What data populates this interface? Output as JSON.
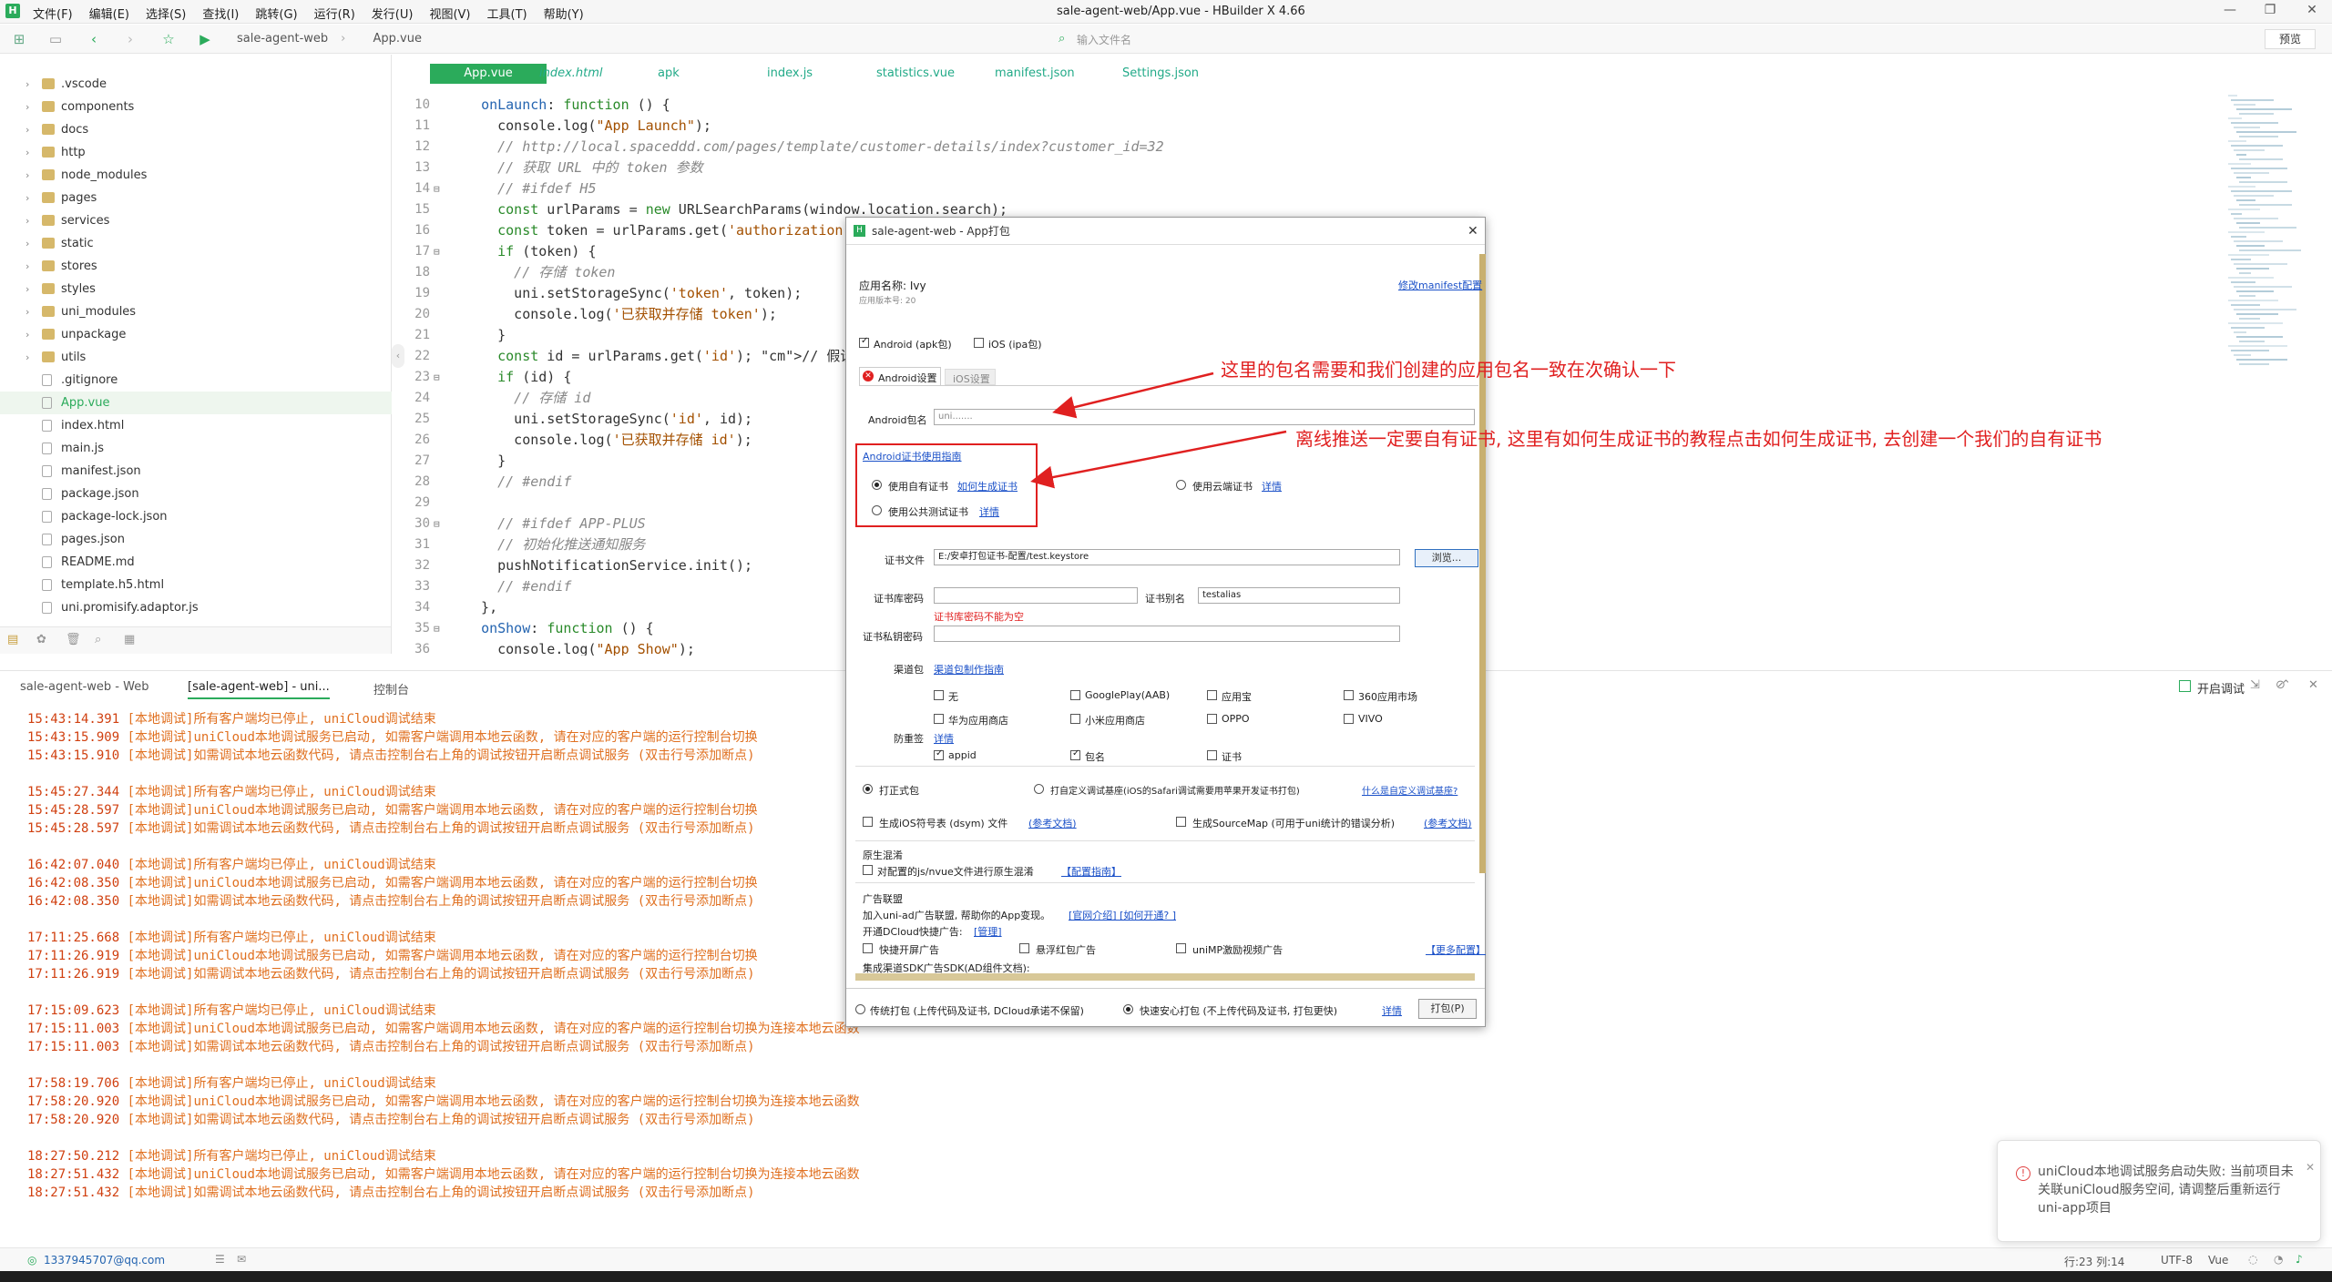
{
  "titlebar": {
    "logo": "H",
    "menus": [
      "文件(F)",
      "编辑(E)",
      "选择(S)",
      "查找(I)",
      "跳转(G)",
      "运行(R)",
      "发行(U)",
      "视图(V)",
      "工具(T)",
      "帮助(Y)"
    ],
    "title": "sale-agent-web/App.vue - HBuilder X 4.66"
  },
  "toolbar": {
    "crumb": [
      "sale-agent-web",
      "App.vue"
    ],
    "file_input_placeholder": "输入文件名",
    "preview": "预览"
  },
  "sidebar": {
    "items": [
      {
        "label": ".vscode",
        "type": "folder"
      },
      {
        "label": "components",
        "type": "folder"
      },
      {
        "label": "docs",
        "type": "folder"
      },
      {
        "label": "http",
        "type": "folder"
      },
      {
        "label": "node_modules",
        "type": "folder"
      },
      {
        "label": "pages",
        "type": "folder"
      },
      {
        "label": "services",
        "type": "folder"
      },
      {
        "label": "static",
        "type": "folder"
      },
      {
        "label": "stores",
        "type": "folder"
      },
      {
        "label": "styles",
        "type": "folder"
      },
      {
        "label": "uni_modules",
        "type": "folder"
      },
      {
        "label": "unpackage",
        "type": "folder"
      },
      {
        "label": "utils",
        "type": "folder"
      },
      {
        "label": ".gitignore",
        "type": "file"
      },
      {
        "label": "App.vue",
        "type": "file",
        "selected": true
      },
      {
        "label": "index.html",
        "type": "file"
      },
      {
        "label": "main.js",
        "type": "file"
      },
      {
        "label": "manifest.json",
        "type": "file"
      },
      {
        "label": "package.json",
        "type": "file"
      },
      {
        "label": "package-lock.json",
        "type": "file"
      },
      {
        "label": "pages.json",
        "type": "file"
      },
      {
        "label": "README.md",
        "type": "file"
      },
      {
        "label": "template.h5.html",
        "type": "file"
      },
      {
        "label": "uni.promisify.adaptor.js",
        "type": "file"
      }
    ]
  },
  "tabs": [
    {
      "label": "App.vue",
      "active": true
    },
    {
      "label": "index.html"
    },
    {
      "label": "apk"
    },
    {
      "label": "index.js"
    },
    {
      "label": "statistics.vue"
    },
    {
      "label": "manifest.json"
    },
    {
      "label": "Settings.json"
    }
  ],
  "code": [
    {
      "n": "10",
      "f": "",
      "t": "  onLaunch: function () {"
    },
    {
      "n": "11",
      "f": "",
      "t": "    console.log(\"App Launch\");"
    },
    {
      "n": "12",
      "f": "",
      "t": "    // http://local.spaceddd.com/pages/template/customer-details/index?customer_id=32"
    },
    {
      "n": "13",
      "f": "",
      "t": "    // 获取 URL 中的 token 参数"
    },
    {
      "n": "14",
      "f": "⊟",
      "t": "    // #ifdef H5"
    },
    {
      "n": "15",
      "f": "",
      "t": "    const urlParams = new URLSearchParams(window.location.search);"
    },
    {
      "n": "16",
      "f": "",
      "t": "    const token = urlParams.get('authorization');"
    },
    {
      "n": "17",
      "f": "⊟",
      "t": "    if (token) {"
    },
    {
      "n": "18",
      "f": "",
      "t": "      // 存储 token"
    },
    {
      "n": "19",
      "f": "",
      "t": "      uni.setStorageSync('token', token);"
    },
    {
      "n": "20",
      "f": "",
      "t": "      console.log('已获取并存储 token');"
    },
    {
      "n": "21",
      "f": "",
      "t": "    }"
    },
    {
      "n": "22",
      "f": "",
      "t": "    const id = urlParams.get('id'); // 假设参数名"
    },
    {
      "n": "23",
      "f": "⊟",
      "t": "    if (id) {"
    },
    {
      "n": "24",
      "f": "",
      "t": "      // 存储 id"
    },
    {
      "n": "25",
      "f": "",
      "t": "      uni.setStorageSync('id', id);"
    },
    {
      "n": "26",
      "f": "",
      "t": "      console.log('已获取并存储 id');"
    },
    {
      "n": "27",
      "f": "",
      "t": "    }"
    },
    {
      "n": "28",
      "f": "",
      "t": "    // #endif"
    },
    {
      "n": "29",
      "f": "",
      "t": ""
    },
    {
      "n": "30",
      "f": "⊟",
      "t": "    // #ifdef APP-PLUS"
    },
    {
      "n": "31",
      "f": "",
      "t": "    // 初始化推送通知服务"
    },
    {
      "n": "32",
      "f": "",
      "t": "    pushNotificationService.init();"
    },
    {
      "n": "33",
      "f": "",
      "t": "    // #endif"
    },
    {
      "n": "34",
      "f": "",
      "t": "  },"
    },
    {
      "n": "35",
      "f": "⊟",
      "t": "  onShow: function () {"
    },
    {
      "n": "36",
      "f": "",
      "t": "    console.log(\"App Show\");"
    }
  ],
  "console_tabs": [
    "sale-agent-web - Web",
    "[sale-agent-web] - uni...",
    "控制台"
  ],
  "console_right": {
    "checkbox": "开启调试"
  },
  "console": [
    {
      "time": "15:43:14.391",
      "msg": " [本地调试]所有客户端均已停止, uniCloud调试结束"
    },
    {
      "time": "15:43:15.909",
      "msg": " [本地调试]uniCloud本地调试服务已启动, 如需客户端调用本地云函数, 请在对应的客户端的运行控制台切换"
    },
    {
      "time": "15:43:15.910",
      "msg": " [本地调试]如需调试本地云函数代码, 请点击控制台右上角的调试按钮开启断点调试服务 (双击行号添加断点)"
    },
    {
      "time": "",
      "msg": ""
    },
    {
      "time": "15:45:27.344",
      "msg": " [本地调试]所有客户端均已停止, uniCloud调试结束"
    },
    {
      "time": "15:45:28.597",
      "msg": " [本地调试]uniCloud本地调试服务已启动, 如需客户端调用本地云函数, 请在对应的客户端的运行控制台切换"
    },
    {
      "time": "15:45:28.597",
      "msg": " [本地调试]如需调试本地云函数代码, 请点击控制台右上角的调试按钮开启断点调试服务 (双击行号添加断点)"
    },
    {
      "time": "",
      "msg": ""
    },
    {
      "time": "16:42:07.040",
      "msg": " [本地调试]所有客户端均已停止, uniCloud调试结束"
    },
    {
      "time": "16:42:08.350",
      "msg": " [本地调试]uniCloud本地调试服务已启动, 如需客户端调用本地云函数, 请在对应的客户端的运行控制台切换"
    },
    {
      "time": "16:42:08.350",
      "msg": " [本地调试]如需调试本地云函数代码, 请点击控制台右上角的调试按钮开启断点调试服务 (双击行号添加断点)"
    },
    {
      "time": "",
      "msg": ""
    },
    {
      "time": "17:11:25.668",
      "msg": " [本地调试]所有客户端均已停止, uniCloud调试结束"
    },
    {
      "time": "17:11:26.919",
      "msg": " [本地调试]uniCloud本地调试服务已启动, 如需客户端调用本地云函数, 请在对应的客户端的运行控制台切换"
    },
    {
      "time": "17:11:26.919",
      "msg": " [本地调试]如需调试本地云函数代码, 请点击控制台右上角的调试按钮开启断点调试服务 (双击行号添加断点)"
    },
    {
      "time": "",
      "msg": ""
    },
    {
      "time": "17:15:09.623",
      "msg": " [本地调试]所有客户端均已停止, uniCloud调试结束"
    },
    {
      "time": "17:15:11.003",
      "msg": " [本地调试]uniCloud本地调试服务已启动, 如需客户端调用本地云函数, 请在对应的客户端的运行控制台切换为连接本地云函数"
    },
    {
      "time": "17:15:11.003",
      "msg": " [本地调试]如需调试本地云函数代码, 请点击控制台右上角的调试按钮开启断点调试服务 (双击行号添加断点)"
    },
    {
      "time": "",
      "msg": ""
    },
    {
      "time": "17:58:19.706",
      "msg": " [本地调试]所有客户端均已停止, uniCloud调试结束"
    },
    {
      "time": "17:58:20.920",
      "msg": " [本地调试]uniCloud本地调试服务已启动, 如需客户端调用本地云函数, 请在对应的客户端的运行控制台切换为连接本地云函数"
    },
    {
      "time": "17:58:20.920",
      "msg": " [本地调试]如需调试本地云函数代码, 请点击控制台右上角的调试按钮开启断点调试服务 (双击行号添加断点)"
    },
    {
      "time": "",
      "msg": ""
    },
    {
      "time": "18:27:50.212",
      "msg": " [本地调试]所有客户端均已停止, uniCloud调试结束"
    },
    {
      "time": "18:27:51.432",
      "msg": " [本地调试]uniCloud本地调试服务已启动, 如需客户端调用本地云函数, 请在对应的客户端的运行控制台切换为连接本地云函数"
    },
    {
      "time": "18:27:51.432",
      "msg": " [本地调试]如需调试本地云函数代码, 请点击控制台右上角的调试按钮开启断点调试服务 (双击行号添加断点)"
    }
  ],
  "status": {
    "user": "1337945707@qq.com",
    "position": "行:23  列:14",
    "encoding": "UTF-8",
    "lang": "Vue"
  },
  "toast": {
    "text": "uniCloud本地调试服务启动失败: 当前项目未关联uniCloud服务空间, 请调整后重新运行uni-app项目"
  },
  "dialog": {
    "title": "sale-agent-web - App打包",
    "app_name_label": "应用名称: Ivy",
    "version_label": "应用版本号: 20",
    "manifest_link": "修改manifest配置",
    "android_cb": "Android (apk包)",
    "ios_cb": "iOS (ipa包)",
    "tab_android": "Android设置",
    "tab_ios": "iOS设置",
    "pkg_label": "Android包名",
    "pkg_value": "uni.......",
    "cert_guide": "Android证书使用指南",
    "own_cert": "使用自有证书",
    "gen_cert": "如何生成证书",
    "cloud_cert": "使用云端证书",
    "detail": "详情",
    "public_cert": "使用公共测试证书",
    "cert_file_label": "证书文件",
    "cert_file_value": "E:/安卓打包证书-配置/test.keystore",
    "browse": "浏览...",
    "keystore_pwd": "证书库密码",
    "alias_label": "证书别名",
    "alias_value": "testalias",
    "pwd_error": "证书库密码不能为空",
    "private_pwd": "证书私钥密码",
    "channel_label": "渠道包",
    "channel_link": "渠道包制作指南",
    "channels": [
      "无",
      "GooglePlay(AAB)",
      "应用宝",
      "360应用市场",
      "华为应用商店",
      "小米应用商店",
      "OPPO",
      "VIVO"
    ],
    "anti_label": "防重签",
    "anti_items": [
      "appid",
      "包名",
      "证书"
    ],
    "formal": "打正式包",
    "custom_base": "打自定义调试基座(iOS的Safari调试需要用苹果开发证书打包)",
    "what_custom": "什么是自定义调试基座?",
    "dsym": "生成iOS符号表 (dsym) 文件",
    "ref_doc": "(参考文档)",
    "sourcemap": "生成SourceMap (可用于uni统计的错误分析)",
    "obfuscate_title": "原生混淆",
    "obfuscate_cb": "对配置的js/nvue文件进行原生混淆",
    "obfuscate_link": "【配置指南】",
    "ad_title": "广告联盟",
    "ad_text": "加入uni-ad广告联盟, 帮助你的App变现。",
    "ad_links": "[官网介绍] [如何开通? ]",
    "dcloud_ad": "开通DCloud快捷广告:",
    "manage": "[管理]",
    "splash_ad": "快捷开屏广告",
    "redpack_ad": "悬浮红包广告",
    "video_ad": "uniMP激励视频广告",
    "more_config": "【更多配置】",
    "sdk_label": "集成渠道SDK广告SDK(AD组件文档):",
    "traditional": "传统打包 (上传代码及证书, DCloud承诺不保留)",
    "fast": "快速安心打包 (不上传代码及证书, 打包更快)",
    "pack_btn": "打包(P)"
  },
  "annotations": {
    "a1": "这里的包名需要和我们创建的应用包名一致在次确认一下",
    "a2": "离线推送一定要自有证书, 这里有如何生成证书的教程点击如何生成证书, 去创建一个我们的自有证书"
  },
  "colors": {
    "accent": "#2bab5b",
    "annotation": "#e02020",
    "console_text": "#e07020"
  }
}
